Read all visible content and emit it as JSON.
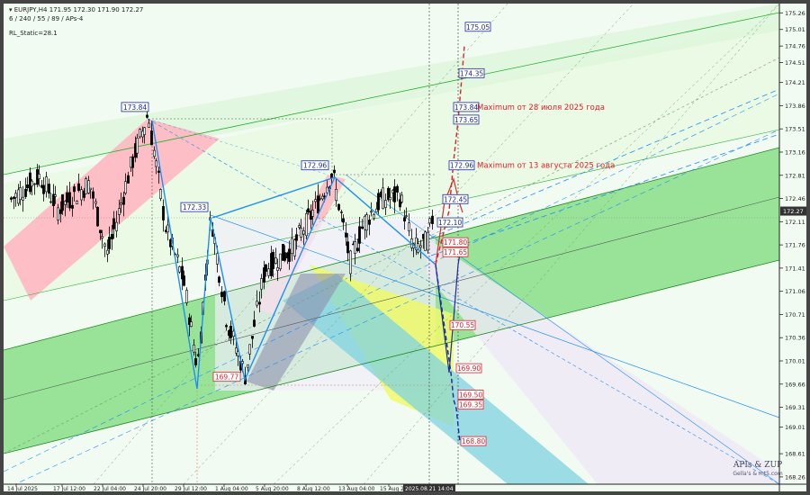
{
  "header": {
    "symbol_line": "EURJPY,H4  171.95 172.30 171.90 172.27",
    "indicator_line": "6 / 240 / 55 / 89 / APs-4",
    "static_label": "RL_Static=28.1"
  },
  "colors": {
    "background": "#f2fbf2",
    "bull_candle": "#000000",
    "green_channel": "#22b02a",
    "pink_channel": "#ff7a8a",
    "blue_line": "#1e8ff0",
    "red_label": "#e0202a"
  },
  "chart_data": {
    "type": "candlestick",
    "symbol": "EURJPY",
    "timeframe": "H4",
    "ohlc_header": {
      "open": 171.95,
      "high": 172.3,
      "low": 171.9,
      "close": 172.27
    },
    "current_price": 172.27,
    "y_axis": {
      "ticks": [
        175.26,
        175.01,
        174.76,
        174.51,
        174.21,
        173.86,
        173.51,
        173.16,
        172.81,
        172.46,
        172.11,
        171.76,
        171.41,
        171.06,
        170.71,
        170.36,
        170.01,
        169.66,
        169.31,
        169.01,
        168.61,
        168.26
      ],
      "range": [
        168.15,
        175.4
      ]
    },
    "x_axis": {
      "ticks": [
        "14 Jul 2025",
        "17 Jul 12:00",
        "22 Jul 04:00",
        "24 Jul 20:00",
        "29 Jul 12:00",
        "1 Aug 04:00",
        "5 Aug 20:00",
        "8 Aug 12:00",
        "13 Aug 04:00",
        "15 Aug 20:00",
        "2025.08.21 14:04"
      ]
    },
    "pivot_labels": [
      {
        "text": "173.84",
        "price": 173.84,
        "side": "blue"
      },
      {
        "text": "172.33",
        "price": 172.33,
        "side": "blue"
      },
      {
        "text": "172.96",
        "price": 172.96,
        "side": "blue"
      },
      {
        "text": "169.77",
        "price": 169.77,
        "side": "red"
      }
    ],
    "target_labels": [
      {
        "text": "175.05",
        "price": 175.05,
        "color": "blue"
      },
      {
        "text": "174.35",
        "price": 174.35,
        "color": "blue"
      },
      {
        "text": "173.84",
        "price": 173.84,
        "color": "blue"
      },
      {
        "text": "173.65",
        "price": 173.65,
        "color": "blue"
      },
      {
        "text": "172.96",
        "price": 172.96,
        "color": "blue"
      },
      {
        "text": "172.45",
        "price": 172.45,
        "color": "blue"
      },
      {
        "text": "172.10",
        "price": 172.1,
        "color": "blue"
      },
      {
        "text": "171.80",
        "price": 171.8,
        "color": "red"
      },
      {
        "text": "171.65",
        "price": 171.65,
        "color": "red"
      },
      {
        "text": "170.55",
        "price": 170.55,
        "color": "red"
      },
      {
        "text": "169.90",
        "price": 169.9,
        "color": "red"
      },
      {
        "text": "169.50",
        "price": 169.5,
        "color": "red"
      },
      {
        "text": "169.35",
        "price": 169.35,
        "color": "red"
      },
      {
        "text": "168.80",
        "price": 168.8,
        "color": "red"
      }
    ],
    "annotations": [
      {
        "text": "Maximum от 28 июля 2025 года",
        "price": 173.84
      },
      {
        "text": "Maximum от 13 августа 2025 года",
        "price": 172.96
      }
    ],
    "grid": false
  },
  "watermark": {
    "line1": "APIs & ZUP",
    "line2": "Gella's & mt5.com"
  }
}
